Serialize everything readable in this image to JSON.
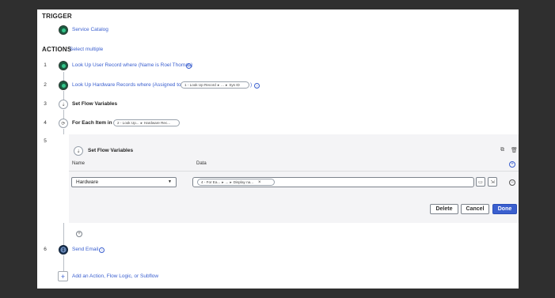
{
  "trigger": {
    "heading": "TRIGGER",
    "item_label": "Service Catalog"
  },
  "actions": {
    "heading": "ACTIONS",
    "select_multiple": "Select multiple",
    "steps": [
      {
        "number": "1",
        "label": "Look Up User Record where (Name is Roel Thomas)"
      },
      {
        "number": "2",
        "label": "Look Up Hardware Records where (Assigned to is",
        "pill_a": "1 - Look Up Record",
        "pill_b": "...",
        "pill_c": "Sys ID",
        "suffix": ")"
      },
      {
        "number": "3",
        "label": "Set Flow Variables"
      },
      {
        "number": "4",
        "label": "For Each Item in",
        "pill_a": "2 - Look Up...",
        "pill_b": "Hardware Rec..."
      },
      {
        "number": "5",
        "label": "Set Flow Variables"
      },
      {
        "number": "6",
        "label": "Send Email"
      }
    ],
    "add_action": "Add an Action, Flow Logic, or Subflow"
  },
  "editor": {
    "col_name": "Name",
    "col_data": "Data",
    "name_value": "Hardware",
    "data_pill_a": "4 - For Ea...",
    "data_pill_b": "...",
    "data_pill_c": "Display na...",
    "delete_label": "Delete",
    "cancel_label": "Cancel",
    "done_label": "Done"
  },
  "colors": {
    "accent": "#3a5fcf",
    "trigger_node": "#1b5c40",
    "email_node": "#1c3557"
  }
}
